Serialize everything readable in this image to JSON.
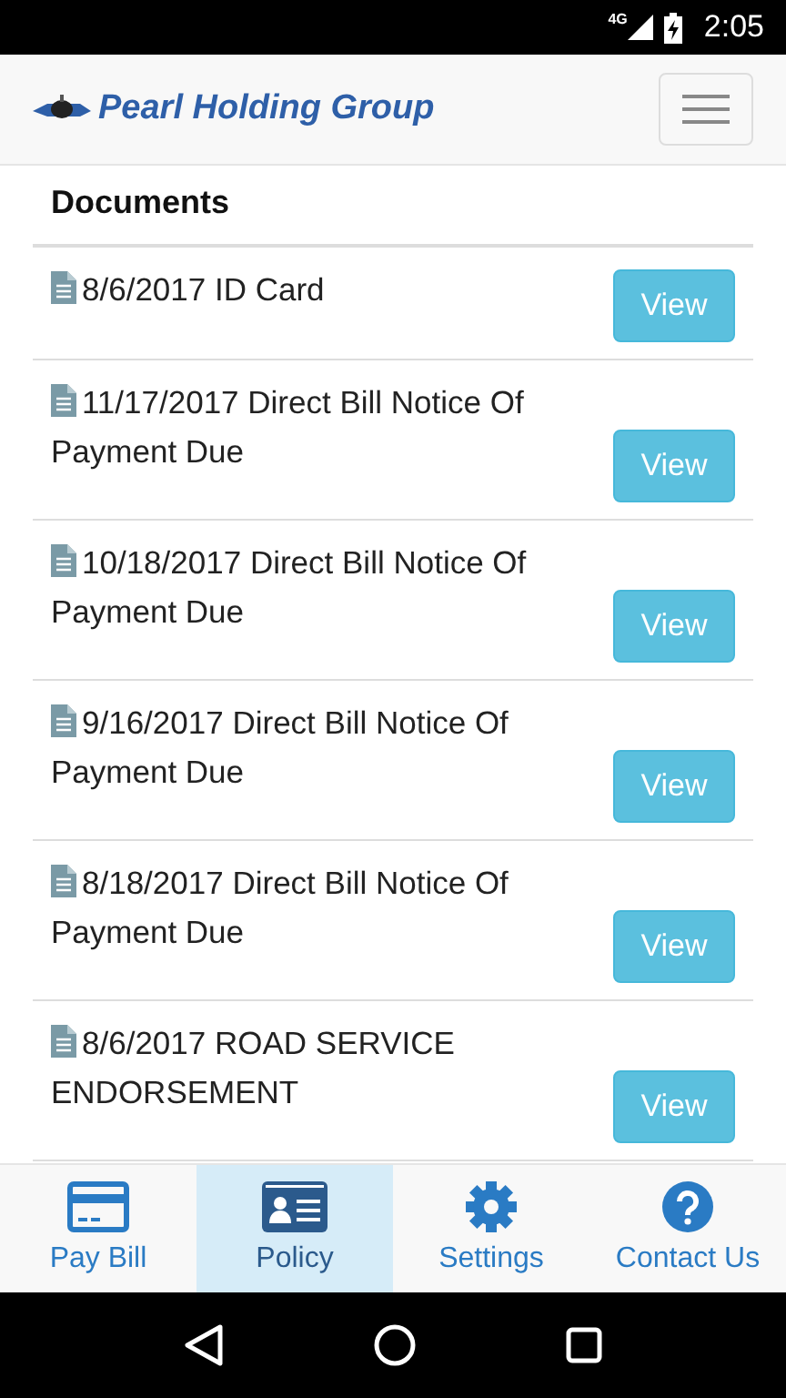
{
  "status_bar": {
    "network": "4G",
    "time": "2:05"
  },
  "header": {
    "brand": "Pearl Holding Group"
  },
  "documents": {
    "title": "Documents",
    "items": [
      {
        "label": "8/6/2017 ID Card",
        "action": "View"
      },
      {
        "label": "11/17/2017 Direct Bill Notice Of Payment Due",
        "action": "View"
      },
      {
        "label": "10/18/2017 Direct Bill Notice Of Payment Due",
        "action": "View"
      },
      {
        "label": "9/16/2017 Direct Bill Notice Of Payment Due",
        "action": "View"
      },
      {
        "label": "8/18/2017 Direct Bill Notice Of Payment Due",
        "action": "View"
      },
      {
        "label": "8/6/2017 ROAD SERVICE ENDORSEMENT",
        "action": "View"
      }
    ]
  },
  "tab_bar": [
    {
      "kind": "card",
      "label": "Pay Bill",
      "selected": false
    },
    {
      "kind": "id",
      "label": "Policy",
      "selected": true
    },
    {
      "kind": "gear",
      "label": "Settings",
      "selected": false
    },
    {
      "kind": "help",
      "label": "Contact Us",
      "selected": false
    }
  ]
}
